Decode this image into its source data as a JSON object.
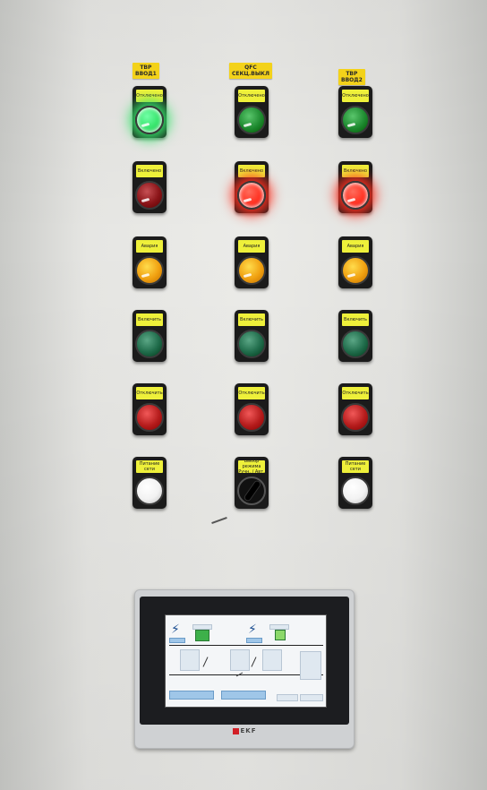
{
  "tags": [
    {
      "text": "ТВР\nВВОД1"
    },
    {
      "text": "QFC\nСЕКЦ.ВЫКЛ"
    },
    {
      "text": "ТВР\nВВОД2"
    }
  ],
  "rows": [
    {
      "kind": "lamp",
      "labels": [
        "Отключено",
        "Отключено",
        "Отключено"
      ],
      "colors": [
        "#35e36a",
        "#1e8a30",
        "#1e8a30"
      ],
      "glow": [
        true,
        false,
        false
      ]
    },
    {
      "kind": "lamp",
      "labels": [
        "Включено",
        "Включено",
        "Включено"
      ],
      "colors": [
        "#8a1418",
        "#ff3020",
        "#ff3020"
      ],
      "glow": [
        false,
        true,
        true
      ]
    },
    {
      "kind": "lamp",
      "labels": [
        "Авария",
        "Авария",
        "Авария"
      ],
      "colors": [
        "#f0a010",
        "#f0a010",
        "#f0a010"
      ],
      "glow": [
        false,
        false,
        false
      ]
    },
    {
      "kind": "button",
      "labels": [
        "Включить",
        "Включить",
        "Включить"
      ],
      "colors": [
        "#1f6b4a",
        "#1f6b4a",
        "#1f6b4a"
      ],
      "glow": [
        false,
        false,
        false
      ]
    },
    {
      "kind": "button",
      "labels": [
        "Отключить",
        "Отключить",
        "Отключить"
      ],
      "colors": [
        "#b51c1c",
        "#b51c1c",
        "#b51c1c"
      ],
      "glow": [
        false,
        false,
        false
      ]
    },
    {
      "kind": "mixed",
      "labels": [
        "Питание\nсети",
        "Выбор режима\nРучн. / Авт.",
        "Питание\nсети"
      ],
      "colors": [
        "#f2f2f2",
        "#000000",
        "#f2f2f2"
      ],
      "glow": [
        false,
        false,
        false
      ]
    }
  ],
  "hmi": {
    "brand": "EKF",
    "screen_title": ""
  }
}
